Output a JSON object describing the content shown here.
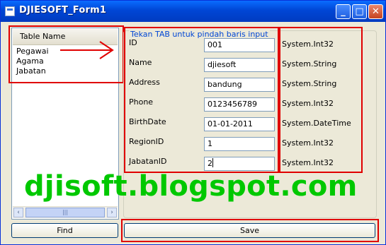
{
  "window": {
    "title": "DJIESOFT_Form1",
    "min_glyph": "_",
    "max_glyph": "□",
    "close_glyph": "✕"
  },
  "table_list": {
    "header": "Table Name",
    "items": [
      "Pegawai",
      "Agama",
      "Jabatan"
    ],
    "scroll_left": "‹",
    "scroll_right": "›",
    "thumb_grip": "|||"
  },
  "form": {
    "hint": "Tekan TAB untuk pindah baris input",
    "fields": [
      {
        "label": "ID",
        "value": "001",
        "type": "System.Int32"
      },
      {
        "label": "Name",
        "value": "djiesoft",
        "type": "System.String"
      },
      {
        "label": "Address",
        "value": "bandung",
        "type": "System.String"
      },
      {
        "label": "Phone",
        "value": "0123456789",
        "type": "System.Int32"
      },
      {
        "label": "BirthDate",
        "value": "01-01-2011",
        "type": "System.DateTime"
      },
      {
        "label": "RegionID",
        "value": "1",
        "type": "System.Int32"
      },
      {
        "label": "JabatanID",
        "value": "2",
        "type": "System.Int32"
      }
    ]
  },
  "buttons": {
    "find": "Find",
    "save": "Save"
  },
  "watermark": "djisoft.blogspot.com",
  "colors": {
    "annotation": "#e00000",
    "watermark": "#00c800",
    "hint": "#0046d5",
    "titlebar": "#0046d5"
  }
}
